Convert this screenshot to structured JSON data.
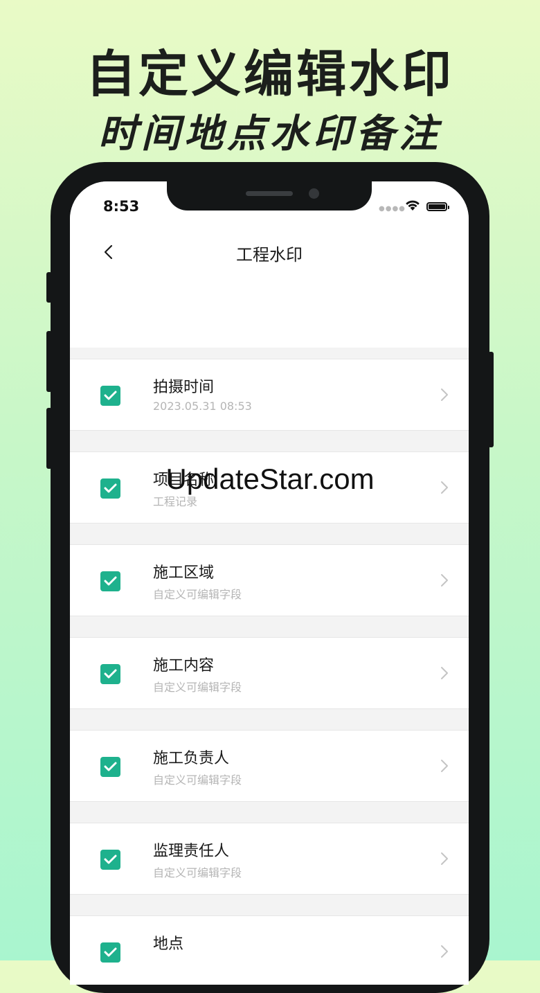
{
  "promo": {
    "headline": "自定义编辑水印",
    "subheadline": "时间地点水印备注"
  },
  "status_bar": {
    "time": "8:53",
    "icons": [
      "signal-dots-icon",
      "wifi-icon",
      "battery-icon"
    ]
  },
  "navbar": {
    "back_icon": "chevron-left-icon",
    "title": "工程水印"
  },
  "items": [
    {
      "title": "拍摄时间",
      "subtitle": "2023.05.31 08:53",
      "checked": true
    },
    {
      "title": "项目名称",
      "subtitle": "工程记录",
      "checked": true
    },
    {
      "title": "施工区域",
      "subtitle": "自定义可编辑字段",
      "checked": true
    },
    {
      "title": "施工内容",
      "subtitle": "自定义可编辑字段",
      "checked": true
    },
    {
      "title": "施工负责人",
      "subtitle": "自定义可编辑字段",
      "checked": true
    },
    {
      "title": "监理责任人",
      "subtitle": "自定义可编辑字段",
      "checked": true
    },
    {
      "title": "地点",
      "subtitle": "",
      "checked": true
    }
  ],
  "overlay_watermark": "UpdateStar.com",
  "colors": {
    "accent": "#1eb18d",
    "background_top": "#e9fac6",
    "background_bottom": "#a9f5cf",
    "phone_frame": "#141617"
  }
}
